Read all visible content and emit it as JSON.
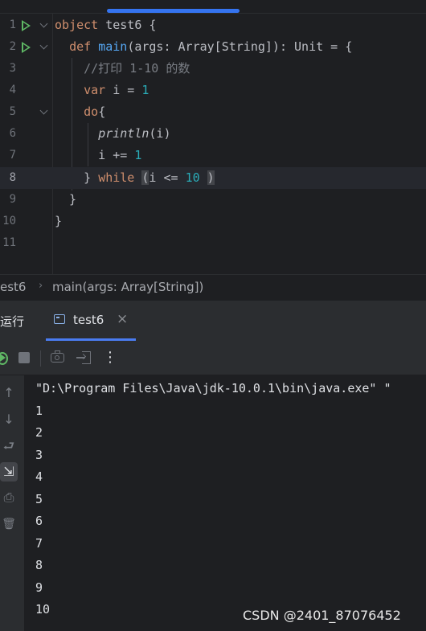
{
  "editor": {
    "lines": [
      {
        "n": "1",
        "tokens": [
          {
            "t": "object",
            "c": "kw"
          },
          {
            "t": " test6 {",
            "c": ""
          }
        ]
      },
      {
        "n": "2",
        "tokens": [
          {
            "t": "  ",
            "c": ""
          },
          {
            "t": "def",
            "c": "kw"
          },
          {
            "t": " ",
            "c": ""
          },
          {
            "t": "main",
            "c": "fn"
          },
          {
            "t": "(args: Array[String]): Unit = {",
            "c": ""
          }
        ]
      },
      {
        "n": "3",
        "tokens": [
          {
            "t": "    ",
            "c": ""
          },
          {
            "t": "//打印 1-10 的数",
            "c": "cm"
          }
        ]
      },
      {
        "n": "4",
        "tokens": [
          {
            "t": "    ",
            "c": ""
          },
          {
            "t": "var",
            "c": "kw"
          },
          {
            "t": " i = ",
            "c": ""
          },
          {
            "t": "1",
            "c": "num"
          }
        ]
      },
      {
        "n": "5",
        "tokens": [
          {
            "t": "    ",
            "c": ""
          },
          {
            "t": "do",
            "c": "kw"
          },
          {
            "t": "{",
            "c": ""
          }
        ]
      },
      {
        "n": "6",
        "tokens": [
          {
            "t": "      ",
            "c": ""
          },
          {
            "t": "println",
            "c": "it"
          },
          {
            "t": "(i)",
            "c": ""
          }
        ]
      },
      {
        "n": "7",
        "tokens": [
          {
            "t": "      i += ",
            "c": ""
          },
          {
            "t": "1",
            "c": "num"
          }
        ]
      },
      {
        "n": "8",
        "tokens": [
          {
            "t": "    } ",
            "c": ""
          },
          {
            "t": "while",
            "c": "kw"
          },
          {
            "t": " ",
            "c": ""
          },
          {
            "t": "(",
            "c": "brace-hl"
          },
          {
            "t": "i <= ",
            "c": ""
          },
          {
            "t": "10",
            "c": "num"
          },
          {
            "t": " ",
            "c": ""
          },
          {
            "t": ")",
            "c": "brace-hl"
          }
        ]
      },
      {
        "n": "9",
        "tokens": [
          {
            "t": "  }",
            "c": ""
          }
        ]
      },
      {
        "n": "10",
        "tokens": [
          {
            "t": "}",
            "c": ""
          }
        ]
      },
      {
        "n": "11",
        "tokens": []
      }
    ],
    "current_line": "8"
  },
  "breadcrumbs": {
    "object": "est6",
    "method": "main(args: Array[String])"
  },
  "run_panel": {
    "title": "运行",
    "tab_label": "test6",
    "close_glyph": "×"
  },
  "toolbar": {
    "more_glyph": "⋮"
  },
  "sidebar": {
    "up_glyph": "↑",
    "down_glyph": "↓",
    "wrap_glyph": "⮐",
    "scroll_glyph": "⇲",
    "print_glyph": "⎙",
    "trash_glyph": "🗑"
  },
  "console": {
    "lines": [
      "\"D:\\Program Files\\Java\\jdk-10.0.1\\bin\\java.exe\" \"",
      "1",
      "2",
      "3",
      "4",
      "5",
      "6",
      "7",
      "8",
      "9",
      "10"
    ]
  },
  "watermark": "CSDN @2401_87076452"
}
